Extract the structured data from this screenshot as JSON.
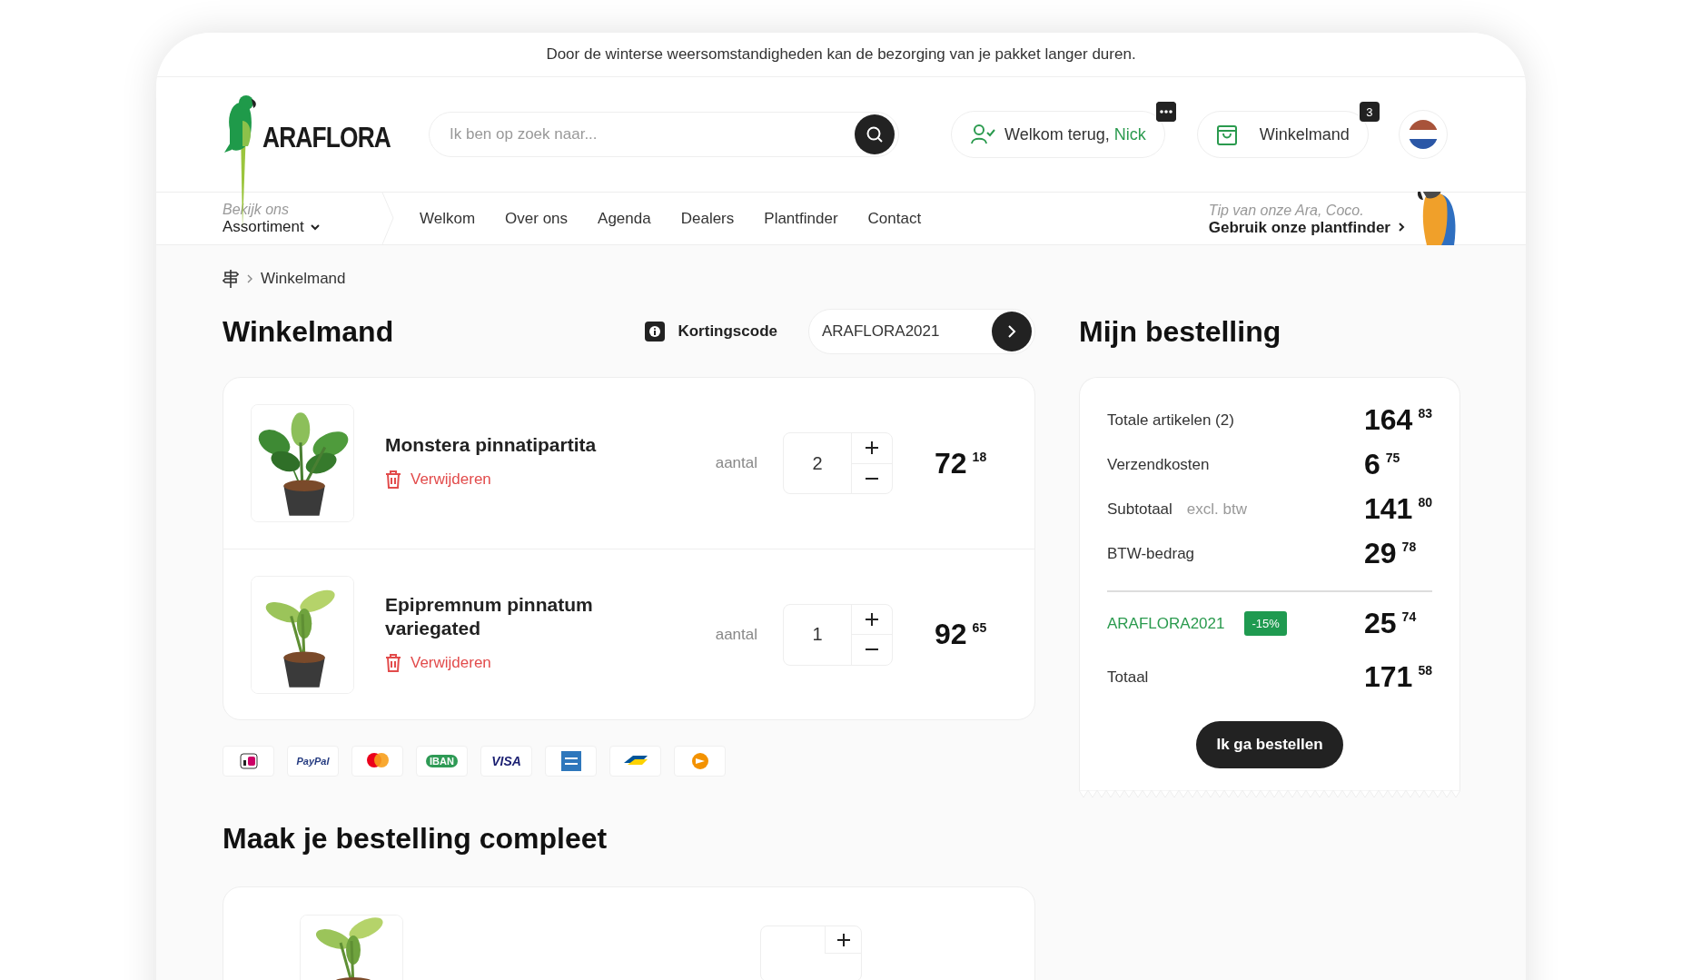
{
  "announcement": "Door de winterse weersomstandigheden kan de bezorging van je pakket langer duren.",
  "header": {
    "logo": "ARAFLORA",
    "search": {
      "placeholder": "Ik ben op zoek naar..."
    },
    "account": {
      "greeting": "Welkom terug,",
      "name": "Nick"
    },
    "cart": {
      "label": "Winkelmand",
      "count": "3"
    }
  },
  "nav": {
    "assortment": {
      "caption": "Bekijk ons",
      "label": "Assortiment"
    },
    "items": [
      {
        "label": "Welkom"
      },
      {
        "label": "Over ons"
      },
      {
        "label": "Agenda"
      },
      {
        "label": "Dealers"
      },
      {
        "label": "Plantfinder"
      },
      {
        "label": "Contact"
      }
    ],
    "tip": {
      "caption": "Tip van onze Ara, Coco.",
      "link": "Gebruik onze plantfinder"
    }
  },
  "breadcrumb": [
    "Winkelmand"
  ],
  "cart": {
    "title": "Winkelmand",
    "coupon": {
      "label": "Kortingscode",
      "value": "ARAFLORA2021"
    },
    "items": [
      {
        "name": "Monstera pinnatipartita",
        "remove": "Verwijderen",
        "qty_label": "aantal",
        "qty": "2",
        "price": {
          "whole": "72",
          "cents": "18"
        }
      },
      {
        "name": "Epipremnum pinnatum variegated",
        "remove": "Verwijderen",
        "qty_label": "aantal",
        "qty": "1",
        "price": {
          "whole": "92",
          "cents": "65"
        }
      }
    ],
    "payments": [
      {
        "kind": "ideal"
      },
      {
        "kind": "paypal",
        "label": "PayPal"
      },
      {
        "kind": "mastercard"
      },
      {
        "kind": "iban",
        "label": "IBAN"
      },
      {
        "kind": "visa",
        "label": "VISA"
      },
      {
        "kind": "amex"
      },
      {
        "kind": "bancontact"
      },
      {
        "kind": "postnl"
      }
    ]
  },
  "upsell": {
    "title": "Maak je bestelling compleet"
  },
  "summary": {
    "title": "Mijn bestelling",
    "lines": [
      {
        "label": "Totale artikelen (2)",
        "amount": {
          "whole": "164",
          "cents": "83"
        }
      },
      {
        "label": "Verzendkosten",
        "amount": {
          "whole": "6",
          "cents": "75"
        }
      },
      {
        "label": "Subtotaal",
        "note": "excl. btw",
        "amount": {
          "whole": "141",
          "cents": "80"
        }
      },
      {
        "label": "BTW-bedrag",
        "amount": {
          "whole": "29",
          "cents": "78"
        }
      }
    ],
    "discount": {
      "code": "ARAFLORA2021",
      "badge": "-15%",
      "amount": {
        "whole": "25",
        "cents": "74"
      }
    },
    "total": {
      "label": "Totaal",
      "amount": {
        "whole": "171",
        "cents": "58"
      }
    },
    "button": "Ik ga bestellen"
  }
}
